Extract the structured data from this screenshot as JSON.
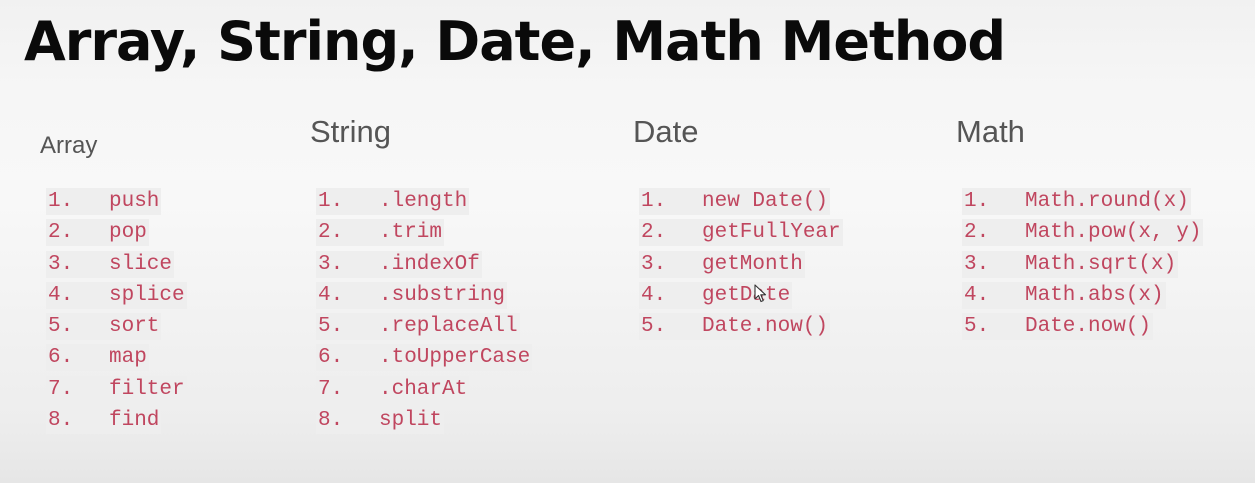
{
  "title": "Array, String, Date, Math Method",
  "columns": [
    {
      "heading": "Array",
      "items": [
        {
          "num": "1.",
          "text": "push"
        },
        {
          "num": "2.",
          "text": "pop"
        },
        {
          "num": "3.",
          "text": "slice"
        },
        {
          "num": "4.",
          "text": "splice"
        },
        {
          "num": "5.",
          "text": "sort"
        },
        {
          "num": "6.",
          "text": "map"
        },
        {
          "num": "7.",
          "text": "filter"
        },
        {
          "num": "8.",
          "text": "find"
        }
      ]
    },
    {
      "heading": "String",
      "items": [
        {
          "num": "1.",
          "text": ".length"
        },
        {
          "num": "2.",
          "text": ".trim"
        },
        {
          "num": "3.",
          "text": ".indexOf"
        },
        {
          "num": "4.",
          "text": ".substring"
        },
        {
          "num": "5.",
          "text": ".replaceAll"
        },
        {
          "num": "6.",
          "text": ".toUpperCase"
        },
        {
          "num": "7.",
          "text": ".charAt"
        },
        {
          "num": "8.",
          "text": "split"
        }
      ]
    },
    {
      "heading": "Date",
      "items": [
        {
          "num": "1.",
          "text": "new Date()"
        },
        {
          "num": "2.",
          "text": "getFullYear"
        },
        {
          "num": "3.",
          "text": "getMonth"
        },
        {
          "num": "4.",
          "text": "getDate"
        },
        {
          "num": "5.",
          "text": "Date.now()"
        }
      ]
    },
    {
      "heading": "Math",
      "items": [
        {
          "num": "1.",
          "text": "Math.round(x)"
        },
        {
          "num": "2.",
          "text": "Math.pow(x, y)"
        },
        {
          "num": "3.",
          "text": "Math.sqrt(x)"
        },
        {
          "num": "4.",
          "text": "Math.abs(x)"
        },
        {
          "num": "5.",
          "text": "Date.now()"
        }
      ]
    }
  ],
  "colors": {
    "code_text": "#c0465f",
    "code_background": "#eeeeee",
    "heading_text": "#555555",
    "title_text": "#0a0a0a"
  },
  "icons": {
    "cursor": "mouse-pointer-icon"
  }
}
